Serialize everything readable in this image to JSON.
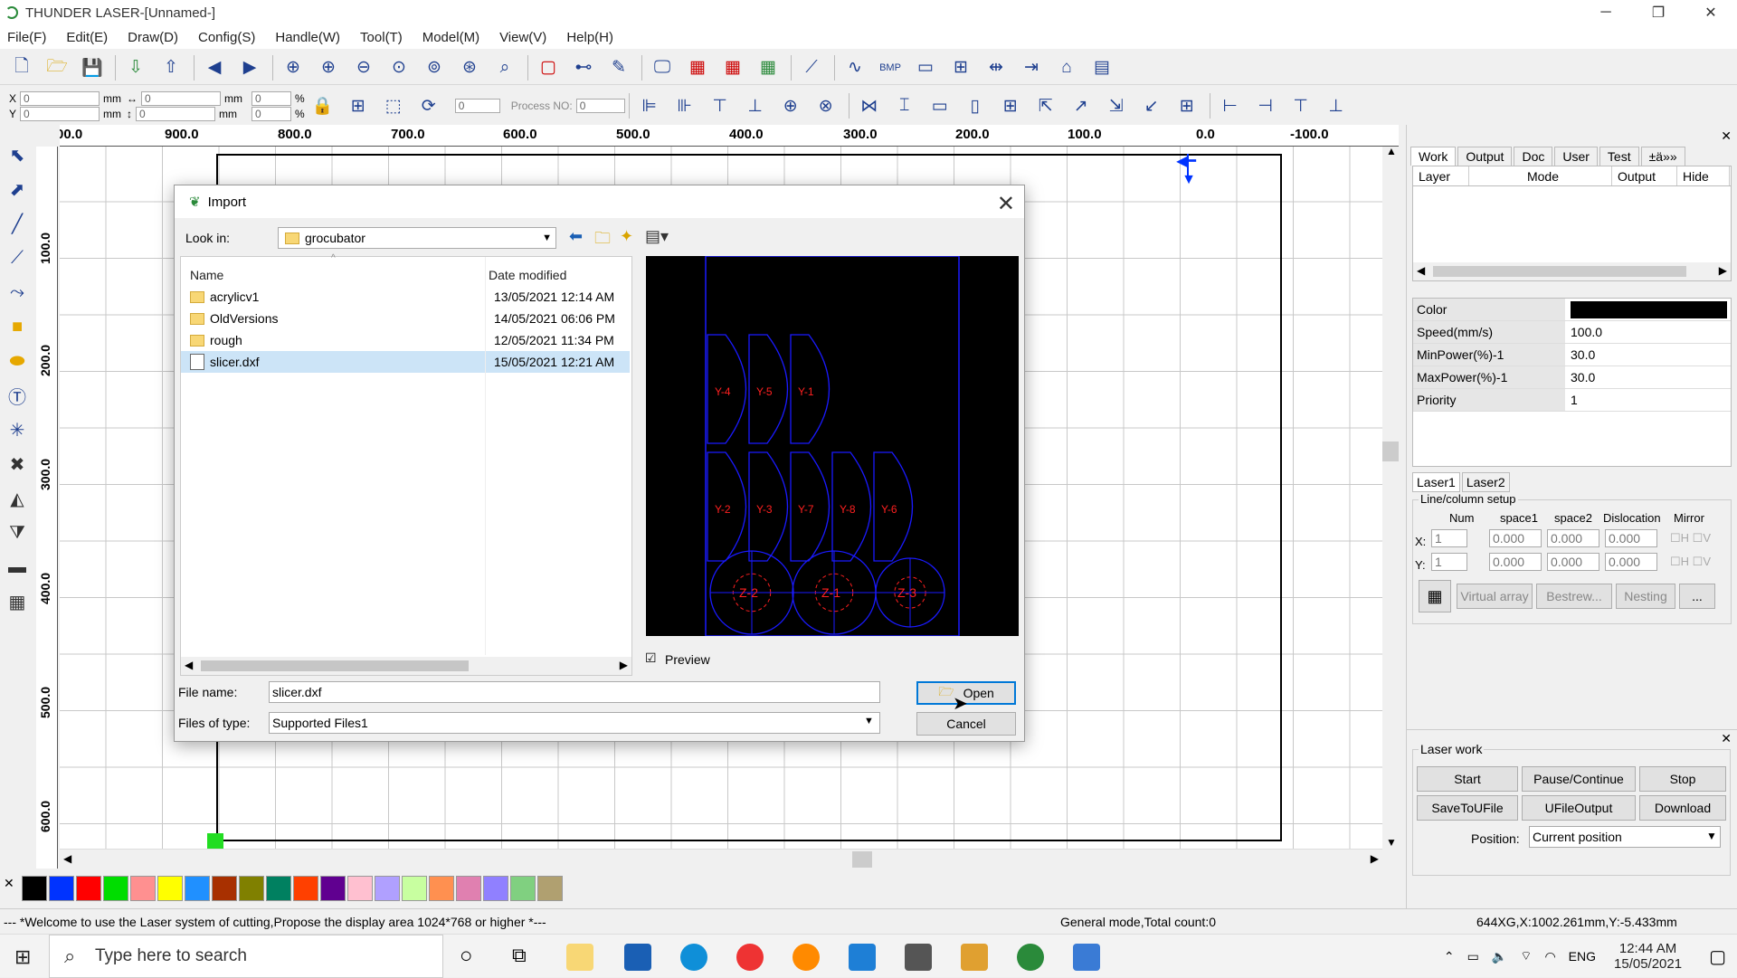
{
  "window": {
    "title": "THUNDER LASER-[Unnamed-]"
  },
  "menu": [
    "File(F)",
    "Edit(E)",
    "Draw(D)",
    "Config(S)",
    "Handle(W)",
    "Tool(T)",
    "Model(M)",
    "View(V)",
    "Help(H)"
  ],
  "coords": {
    "x_label": "X",
    "y_label": "Y",
    "x_value": "0",
    "y_value": "0",
    "unit": "mm",
    "w_value": "0",
    "h_value": "0",
    "x_scale": "0",
    "y_scale": "0",
    "pct": "%",
    "rotate_value": "0",
    "process_no_label": "Process NO:",
    "process_no_value": "0"
  },
  "ruler_h": [
    "00.0",
    "900.0",
    "800.0",
    "700.0",
    "600.0",
    "500.0",
    "400.0",
    "300.0",
    "200.0",
    "100.0",
    "0.0",
    "-100.0"
  ],
  "ruler_v": [
    "100.0",
    "200.0",
    "300.0",
    "400.0",
    "500.0",
    "600.0"
  ],
  "dialog": {
    "title": "Import",
    "look_in_label": "Look in:",
    "look_in_value": "grocubator",
    "columns": {
      "name": "Name",
      "date": "Date modified"
    },
    "files": [
      {
        "name": "acrylicv1",
        "date": "13/05/2021 12:14 AM",
        "type": "folder"
      },
      {
        "name": "OldVersions",
        "date": "14/05/2021 06:06 PM",
        "type": "folder"
      },
      {
        "name": "rough",
        "date": "12/05/2021 11:34 PM",
        "type": "folder"
      },
      {
        "name": "slicer.dxf",
        "date": "15/05/2021 12:21 AM",
        "type": "file"
      }
    ],
    "preview_label": "Preview",
    "file_name_label": "File name:",
    "file_name_value": "slicer.dxf",
    "file_type_label": "Files of type:",
    "file_type_value": "Supported Files1",
    "open_label": "Open",
    "cancel_label": "Cancel",
    "preview_parts": [
      "Y-4",
      "Y-5",
      "Y-1",
      "Y-2",
      "Y-3",
      "Y-7",
      "Y-8",
      "Y-6",
      "Z-2",
      "Z-1",
      "Z-3"
    ]
  },
  "right_panel": {
    "tabs": [
      "Work",
      "Output",
      "Doc",
      "User",
      "Test",
      "±ä»»"
    ],
    "layer_cols": [
      "Layer",
      "Mode",
      "Output",
      "Hide"
    ],
    "props": [
      {
        "k": "Color",
        "v": ""
      },
      {
        "k": "Speed(mm/s)",
        "v": "100.0"
      },
      {
        "k": "MinPower(%)-1",
        "v": "30.0"
      },
      {
        "k": "MaxPower(%)-1",
        "v": "30.0"
      },
      {
        "k": "Priority",
        "v": "1"
      }
    ],
    "laser_tabs": [
      "Laser1",
      "Laser2"
    ],
    "line_column_title": "Line/column setup",
    "lc_cols": [
      "Num",
      "space1",
      "space2",
      "Dislocation",
      "Mirror"
    ],
    "lc_x": {
      "label": "X:",
      "num": "1",
      "s1": "0.000",
      "s2": "0.000",
      "dis": "0.000"
    },
    "lc_y": {
      "label": "Y:",
      "num": "1",
      "s1": "0.000",
      "s2": "0.000",
      "dis": "0.000"
    },
    "mirror_h": "H",
    "mirror_v": "V",
    "array_buttons": [
      "Virtual array",
      "Bestrew...",
      "Nesting",
      "..."
    ],
    "laser_work_title": "Laser work",
    "work_buttons": [
      "Start",
      "Pause/Continue",
      "Stop",
      "SaveToUFile",
      "UFileOutput",
      "Download"
    ],
    "position_label": "Position:",
    "position_value": "Current position"
  },
  "palette_colors": [
    "#000000",
    "#0033ff",
    "#ff0000",
    "#00dd00",
    "#ff9090",
    "#ffff00",
    "#2090ff",
    "#a83000",
    "#808000",
    "#008060",
    "#ff4000",
    "#600090",
    "#ffc0d0",
    "#b0a0ff",
    "#c8ffa0",
    "#ff9050",
    "#e080b0",
    "#9080ff",
    "#80d080",
    "#b0a070"
  ],
  "status": {
    "message": "--- *Welcome to use the Laser system of cutting,Propose the display area 1024*768 or higher *---",
    "mode": "General mode,Total count:0",
    "position": "644XG,X:1002.261mm,Y:-5.433mm"
  },
  "taskbar": {
    "search_placeholder": "Type here to search",
    "lang": "ENG",
    "time": "12:44 AM",
    "date": "15/05/2021"
  },
  "accent": {
    "selection": "#cce4f7",
    "preview_bg": "#000000",
    "preview_stroke": "#1a1aff",
    "preview_text": "#ff2020"
  }
}
